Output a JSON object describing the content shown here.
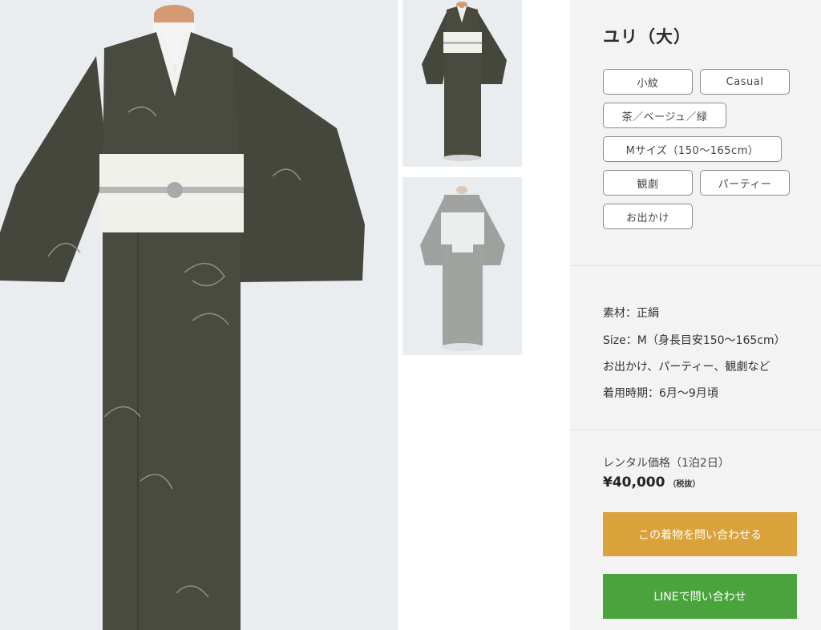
{
  "product": {
    "title": "ユリ（大）"
  },
  "tags": [
    "小紋",
    "Casual",
    "茶／ベージュ／緑",
    "Mサイズ（150〜165cm）",
    "観劇",
    "パーティー",
    "お出かけ"
  ],
  "specs": {
    "material": "素材：正絹",
    "size": "Size：M（身長目安150〜165cm）",
    "occasions": "お出かけ、パーティー、観劇など",
    "season": "着用時期：6月〜9月頃"
  },
  "pricing": {
    "label": "レンタル価格（1泊2日）",
    "price": "¥40,000",
    "tax_note": "（税抜）"
  },
  "buttons": {
    "inquire_label": "この着物を問い合わせる",
    "line_label": "LINEで問い合わせ"
  },
  "colors": {
    "kimono": "#45463c",
    "obi": "#f1f1ec",
    "inquire_button": "#d9a23b",
    "line_button": "#4aa33d",
    "panel_background": "#f3f3f3",
    "photo_background": "#e9edef"
  }
}
